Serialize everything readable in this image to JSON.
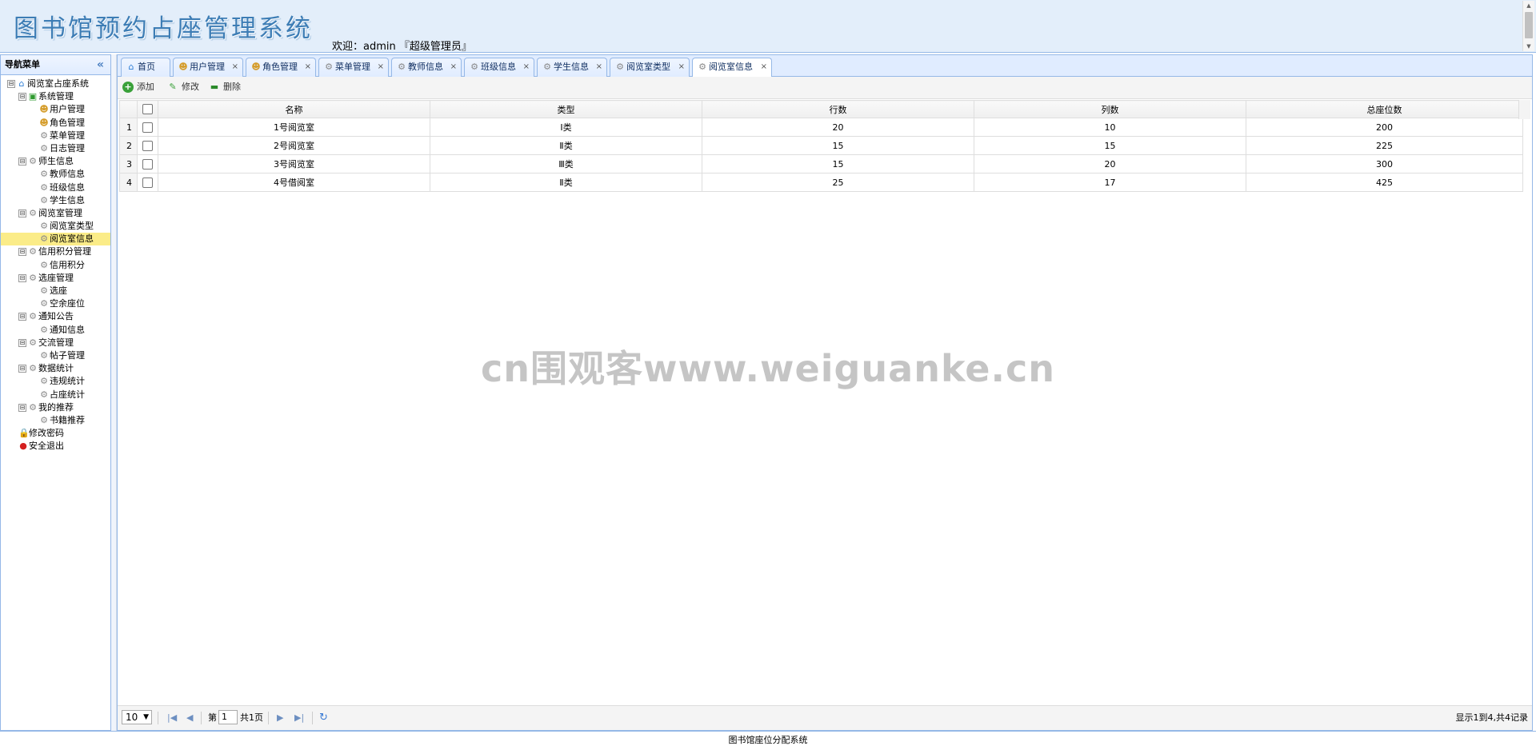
{
  "header": {
    "title": "图书馆预约占座管理系统",
    "welcome": "欢迎：admin 『超级管理员』"
  },
  "nav": {
    "title": "导航菜单",
    "collapse_glyph": "«",
    "tree": [
      {
        "label": "阅览室占座系统",
        "level": 0,
        "icon": "home-icon",
        "expand": "⊟"
      },
      {
        "label": "系统管理",
        "level": 1,
        "icon": "folder-icon",
        "expand": "⊟"
      },
      {
        "label": "用户管理",
        "level": 2,
        "icon": "user-icon"
      },
      {
        "label": "角色管理",
        "level": 2,
        "icon": "users-icon"
      },
      {
        "label": "菜单管理",
        "level": 2,
        "icon": "gear-icon"
      },
      {
        "label": "日志管理",
        "level": 2,
        "icon": "gear-icon"
      },
      {
        "label": "师生信息",
        "level": 1,
        "icon": "gear-icon",
        "expand": "⊟"
      },
      {
        "label": "教师信息",
        "level": 2,
        "icon": "gear-icon"
      },
      {
        "label": "班级信息",
        "level": 2,
        "icon": "gear-icon"
      },
      {
        "label": "学生信息",
        "level": 2,
        "icon": "gear-icon"
      },
      {
        "label": "阅览室管理",
        "level": 1,
        "icon": "gear-icon",
        "expand": "⊟"
      },
      {
        "label": "阅览室类型",
        "level": 2,
        "icon": "gear-icon"
      },
      {
        "label": "阅览室信息",
        "level": 2,
        "icon": "gear-icon",
        "selected": true
      },
      {
        "label": "信用积分管理",
        "level": 1,
        "icon": "gear-icon",
        "expand": "⊟"
      },
      {
        "label": "信用积分",
        "level": 2,
        "icon": "gear-icon"
      },
      {
        "label": "选座管理",
        "level": 1,
        "icon": "gear-icon",
        "expand": "⊟"
      },
      {
        "label": "选座",
        "level": 2,
        "icon": "gear-icon"
      },
      {
        "label": "空余座位",
        "level": 2,
        "icon": "gear-icon"
      },
      {
        "label": "通知公告",
        "level": 1,
        "icon": "gear-icon",
        "expand": "⊟"
      },
      {
        "label": "通知信息",
        "level": 2,
        "icon": "gear-icon"
      },
      {
        "label": "交流管理",
        "level": 1,
        "icon": "gear-icon",
        "expand": "⊟"
      },
      {
        "label": "帖子管理",
        "level": 2,
        "icon": "gear-icon"
      },
      {
        "label": "数据统计",
        "level": 1,
        "icon": "gear-icon",
        "expand": "⊟"
      },
      {
        "label": "违规统计",
        "level": 2,
        "icon": "gear-icon"
      },
      {
        "label": "占座统计",
        "level": 2,
        "icon": "gear-icon"
      },
      {
        "label": "我的推荐",
        "level": 1,
        "icon": "gear-icon",
        "expand": "⊟"
      },
      {
        "label": "书籍推荐",
        "level": 2,
        "icon": "gear-icon"
      },
      {
        "label": "修改密码",
        "level": 1,
        "icon": "lock-icon"
      },
      {
        "label": "安全退出",
        "level": 1,
        "icon": "exit-icon"
      }
    ]
  },
  "tabs": [
    {
      "label": "首页",
      "icon": "home-icon",
      "closable": false
    },
    {
      "label": "用户管理",
      "icon": "user-icon",
      "closable": true
    },
    {
      "label": "角色管理",
      "icon": "users-icon",
      "closable": true
    },
    {
      "label": "菜单管理",
      "icon": "gear-icon",
      "closable": true
    },
    {
      "label": "教师信息",
      "icon": "gear-icon",
      "closable": true
    },
    {
      "label": "班级信息",
      "icon": "gear-icon",
      "closable": true
    },
    {
      "label": "学生信息",
      "icon": "gear-icon",
      "closable": true
    },
    {
      "label": "阅览室类型",
      "icon": "gear-icon",
      "closable": true
    },
    {
      "label": "阅览室信息",
      "icon": "gear-icon",
      "closable": true,
      "active": true
    }
  ],
  "toolbar": {
    "add_label": "添加",
    "edit_label": "修改",
    "delete_label": "删除"
  },
  "grid": {
    "columns": [
      "名称",
      "类型",
      "行数",
      "列数",
      "总座位数"
    ],
    "rows": [
      {
        "no": "1",
        "name": "1号阅览室",
        "type": "Ⅰ类",
        "rows": "20",
        "cols": "10",
        "total": "200"
      },
      {
        "no": "2",
        "name": "2号阅览室",
        "type": "Ⅱ类",
        "rows": "15",
        "cols": "15",
        "total": "225"
      },
      {
        "no": "3",
        "name": "3号阅览室",
        "type": "Ⅲ类",
        "rows": "15",
        "cols": "20",
        "total": "300"
      },
      {
        "no": "4",
        "name": "4号借阅室",
        "type": "Ⅱ类",
        "rows": "25",
        "cols": "17",
        "total": "425"
      }
    ]
  },
  "pager": {
    "page_size": "10",
    "page_prefix": "第",
    "current_page": "1",
    "page_total": "共1页",
    "info": "显示1到4,共4记录"
  },
  "footer": {
    "text": "图书馆座位分配系统"
  },
  "watermark": "cn围观客www.weiguanke.cn"
}
